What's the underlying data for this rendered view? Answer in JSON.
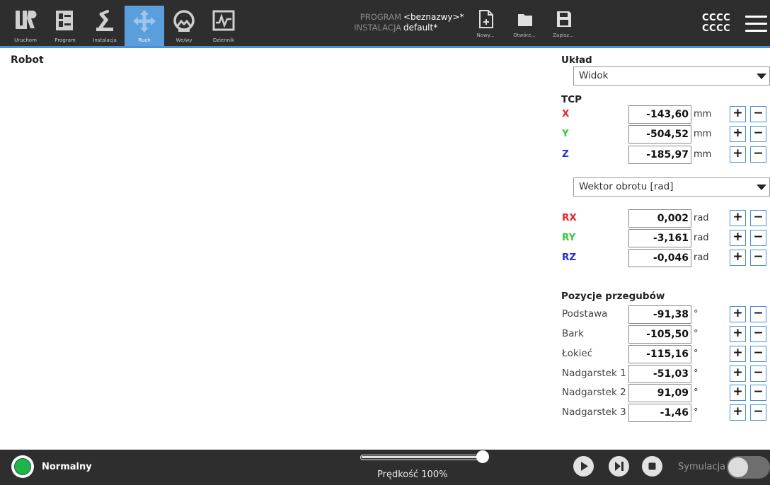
{
  "nav": {
    "tabs": [
      {
        "label": "Uruchom",
        "icon": "ur-logo-icon"
      },
      {
        "label": "Program",
        "icon": "program-icon"
      },
      {
        "label": "Instalacja",
        "icon": "robot-arm-icon"
      },
      {
        "label": "Ruch",
        "icon": "move-arrows-icon",
        "active": true
      },
      {
        "label": "We/wy",
        "icon": "io-icon"
      },
      {
        "label": "Dziennik",
        "icon": "log-chart-icon"
      }
    ]
  },
  "program": {
    "program_key": "PROGRAM",
    "program_value": "<beznazwy>*",
    "installation_key": "INSTALACJA",
    "installation_value": "default*"
  },
  "file_buttons": {
    "new_label": "Nowy...",
    "open_label": "Otwórz...",
    "save_label": "Zapisz..."
  },
  "header_right": {
    "line1": "CCCC",
    "line2": "CCCC"
  },
  "main": {
    "title": "Robot"
  },
  "panel": {
    "layout_title": "Układ",
    "layout_dropdown": "Widok",
    "tcp_title": "TCP",
    "tcp_rows": [
      {
        "label": "X",
        "value": "-143,60",
        "unit": "mm"
      },
      {
        "label": "Y",
        "value": "-504,52",
        "unit": "mm"
      },
      {
        "label": "Z",
        "value": "-185,97",
        "unit": "mm"
      }
    ],
    "rotation_dropdown": "Wektor obrotu [rad]",
    "rot_rows": [
      {
        "label": "RX",
        "value": "0,002",
        "unit": "rad"
      },
      {
        "label": "RY",
        "value": "-3,161",
        "unit": "rad"
      },
      {
        "label": "RZ",
        "value": "-0,046",
        "unit": "rad"
      }
    ],
    "joints_title": "Pozycje przegubów",
    "joint_rows": [
      {
        "label": "Podstawa",
        "value": "-91,38",
        "unit": "°"
      },
      {
        "label": "Bark",
        "value": "-105,50",
        "unit": "°"
      },
      {
        "label": "Łokieć",
        "value": "-115,16",
        "unit": "°"
      },
      {
        "label": "Nadgarstek 1",
        "value": "-51,03",
        "unit": "°"
      },
      {
        "label": "Nadgarstek 2",
        "value": "91,09",
        "unit": "°"
      },
      {
        "label": "Nadgarstek 3",
        "value": "-1,46",
        "unit": "°"
      }
    ],
    "plus_symbol": "+",
    "minus_symbol": "−"
  },
  "footer": {
    "status": "Normalny",
    "status_color": "#22b24c",
    "speed_label": "Prędkość 100%",
    "speed_fraction": 1.0,
    "simulation_label": "Symulacja",
    "simulation_on": false
  },
  "colors": {
    "accent": "#4b8fd6",
    "x_axis": "#e8262b",
    "y_axis": "#39c83d",
    "z_axis": "#2030d8"
  }
}
